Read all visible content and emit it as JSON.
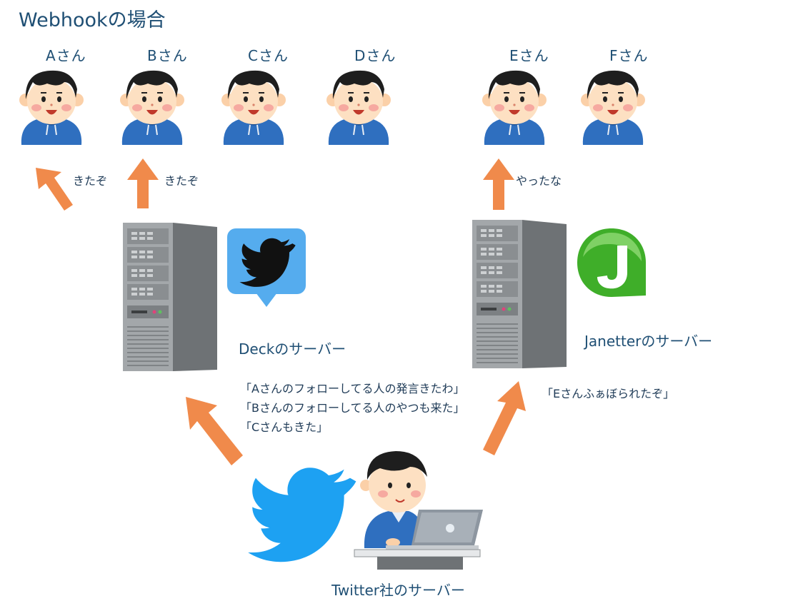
{
  "title": "Webhookの場合",
  "users": [
    {
      "label": "Aさん"
    },
    {
      "label": "Bさん"
    },
    {
      "label": "Cさん"
    },
    {
      "label": "Dさん"
    },
    {
      "label": "Eさん"
    },
    {
      "label": "Fさん"
    }
  ],
  "arrow_labels": {
    "a": "きたぞ",
    "b": "きたぞ",
    "e": "やったな"
  },
  "servers": {
    "deck": "Deckのサーバー",
    "janetter": "Janetterのサーバー",
    "twitter": "Twitter社のサーバー"
  },
  "messages": {
    "deck": [
      "「Aさんのフォローしてる人の発言きたわ」",
      "「Bさんのフォローしてる人のやつも来た」",
      "「Cさんもきた」"
    ],
    "janetter": "「Eさんふぁぼられたぞ」"
  },
  "colors": {
    "arrow": "#f08a4b",
    "twitter_blue": "#1da1f2",
    "deck_blue": "#55acee",
    "janetter_green": "#3fae29",
    "hoodie": "#2f6fbf",
    "server_gray": "#8f9396"
  }
}
